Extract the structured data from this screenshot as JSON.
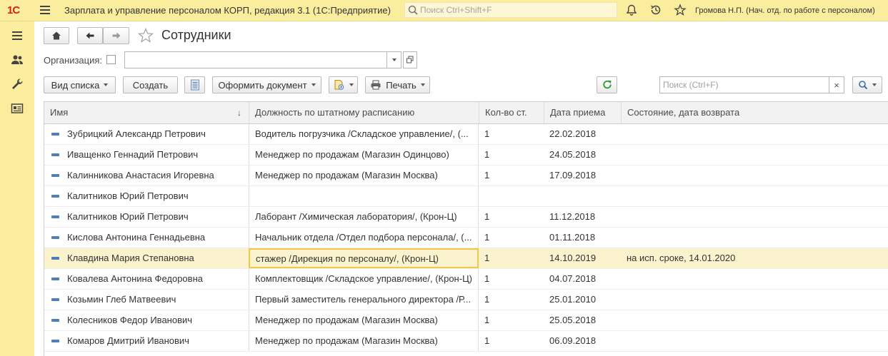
{
  "app": {
    "logo": "1С",
    "title": "Зарплата и управление персоналом КОРП, редакция 3.1  (1С:Предприятие)",
    "search_placeholder": "Поиск Ctrl+Shift+F",
    "user": "Громова Н.П. (Нач. отд. по работе с персоналом)"
  },
  "sidebar": {
    "items": [
      {
        "icon": "menu-icon"
      },
      {
        "icon": "users-icon"
      },
      {
        "icon": "wrench-icon"
      },
      {
        "icon": "id-card-icon"
      }
    ]
  },
  "form": {
    "title": "Сотрудники",
    "org_label": "Организация:",
    "org_value": "",
    "toolbar": {
      "view_list": "Вид списка",
      "create": "Создать",
      "make_document": "Оформить документ",
      "print": "Печать",
      "search_placeholder": "Поиск (Ctrl+F)",
      "clear": "×"
    }
  },
  "table": {
    "columns": [
      "Имя",
      "Должность по штатному расписанию",
      "Кол-во ст.",
      "Дата приема",
      "Состояние, дата возврата"
    ],
    "sort_indicator": "↓",
    "rows": [
      {
        "name": "Зубрицкий Александр Петрович",
        "position": "Водитель погрузчика /Складское управление/, (...",
        "rate": "1",
        "hired": "22.02.2018",
        "state": ""
      },
      {
        "name": "Иващенко Геннадий Петрович",
        "position": "Менеджер по продажам (Магазин Одинцово)",
        "rate": "1",
        "hired": "24.05.2018",
        "state": ""
      },
      {
        "name": "Калинникова Анастасия Игоревна",
        "position": "Менеджер по продажам (Магазин Москва)",
        "rate": "1",
        "hired": "17.09.2018",
        "state": ""
      },
      {
        "name": "Калитников Юрий Петрович",
        "position": "",
        "rate": "",
        "hired": "",
        "state": ""
      },
      {
        "name": "Калитников Юрий Петрович",
        "position": "Лаборант /Химическая лаборатория/, (Крон-Ц)",
        "rate": "1",
        "hired": "11.12.2018",
        "state": ""
      },
      {
        "name": "Кислова Антонина Геннадьевна",
        "position": "Начальник отдела /Отдел подбора персонала/, (...",
        "rate": "1",
        "hired": "01.11.2018",
        "state": ""
      },
      {
        "name": "Клавдина Мария Степановна",
        "position": "стажер /Дирекция по персоналу/, (Крон-Ц)",
        "rate": "1",
        "hired": "14.10.2019",
        "state": "на исп. сроке, 14.01.2020"
      },
      {
        "name": "Ковалева Антонина Федоровна",
        "position": "Комплектовщик /Складское управление/, (Крон-Ц)",
        "rate": "1",
        "hired": "04.07.2018",
        "state": ""
      },
      {
        "name": "Козьмин Глеб Матвеевич",
        "position": "Первый заместитель генерального директора /Р...",
        "rate": "1",
        "hired": "25.01.2010",
        "state": ""
      },
      {
        "name": "Колесников Федор Иванович",
        "position": "Менеджер по продажам (Магазин Москва)",
        "rate": "1",
        "hired": "25.05.2018",
        "state": ""
      },
      {
        "name": "Комаров Дмитрий Иванович",
        "position": "Менеджер по продажам (Магазин Москва)",
        "rate": "1",
        "hired": "06.09.2018",
        "state": ""
      }
    ]
  },
  "colors": {
    "panel": "#fbed9e",
    "selected_row": "#fbf3cd",
    "active_cell_border": "#f1c84a",
    "logo": "#d8201a",
    "refresh": "#2f9a3a"
  }
}
